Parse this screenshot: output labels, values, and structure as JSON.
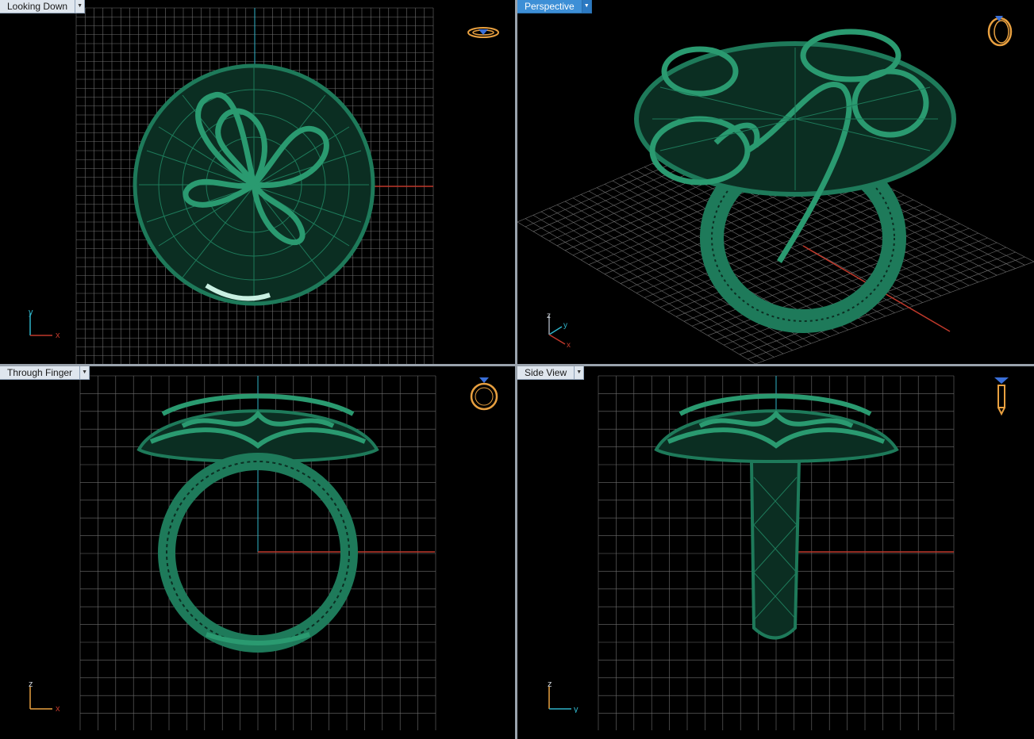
{
  "viewports": [
    {
      "id": "top",
      "title": "Looking Down",
      "active": false,
      "axes": [
        "y",
        "x"
      ]
    },
    {
      "id": "perspective",
      "title": "Perspective",
      "active": true,
      "axes": [
        "z",
        "y",
        "x"
      ]
    },
    {
      "id": "front",
      "title": "Through Finger",
      "active": false,
      "axes": [
        "z",
        "x"
      ]
    },
    {
      "id": "side",
      "title": "Side View",
      "active": false,
      "axes": [
        "z",
        "y"
      ]
    }
  ],
  "colors": {
    "background": "#000000",
    "grid": "#6e6e6e",
    "model": "#1e7a5a",
    "model_light": "#3fae87",
    "axis_x": "#c0392b",
    "axis_y": "#2fb3c8",
    "gizmo": "#e8a040",
    "gizmo_blue": "#3a6fd8",
    "title_active": "#3d8fd6",
    "title_inactive": "#dfe6ee",
    "divider": "#9aa3ad"
  },
  "icons": {
    "top": "ring-top-view-icon",
    "perspective": "ring-perspective-icon",
    "front": "ring-front-view-icon",
    "side": "ring-side-view-icon"
  }
}
